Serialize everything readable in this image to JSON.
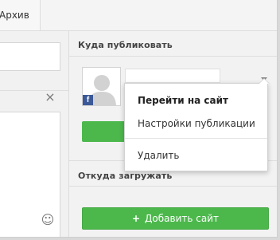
{
  "tabs": {
    "archive_label": "Архив"
  },
  "publish_section": {
    "title": "Куда публиковать",
    "account_icon": "facebook-icon",
    "brand_color": "#3b5998"
  },
  "dropdown": {
    "items": [
      {
        "label": "Перейти на сайт"
      },
      {
        "label": "Настройки публикации"
      },
      {
        "label": "Удалить"
      }
    ]
  },
  "upload_section": {
    "title": "Откуда загружать",
    "add_site_icon": "+",
    "add_site_label": "Добавить сайт",
    "accent_color": "#4cb84c"
  },
  "composer": {
    "close_icon": "×",
    "emoji_icon": "☺"
  }
}
